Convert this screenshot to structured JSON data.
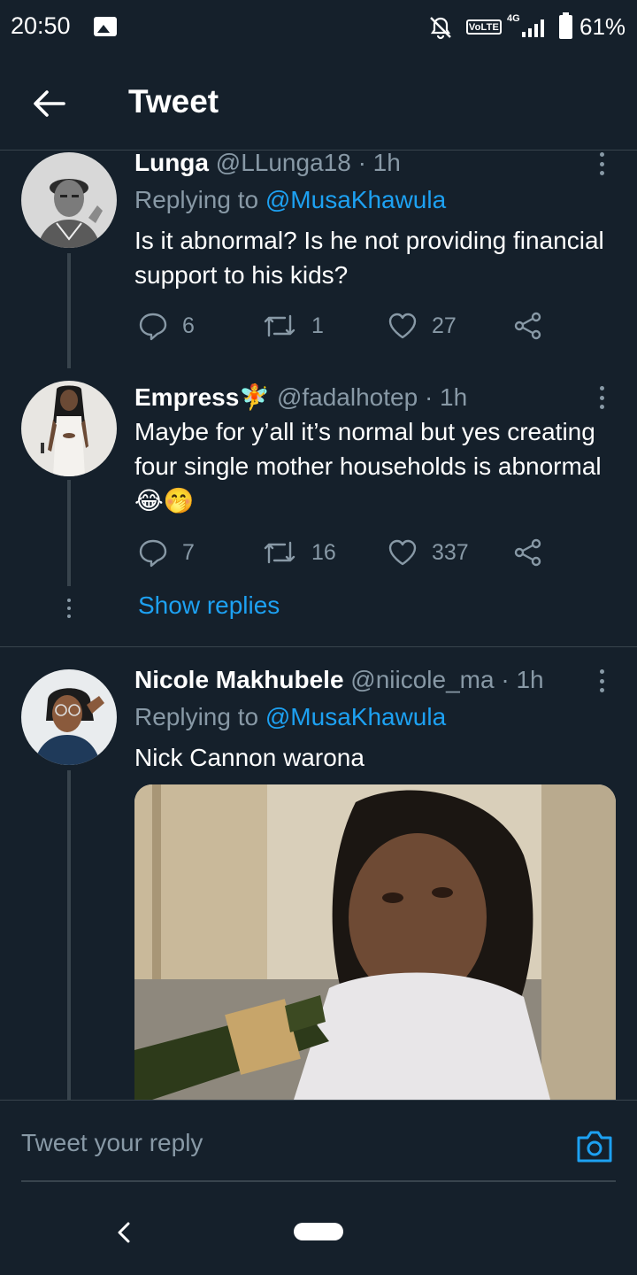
{
  "status_bar": {
    "time": "20:50",
    "volte": "VoLTE",
    "network": "4G",
    "battery_percent": "61%",
    "icons": [
      "gallery-icon",
      "mute-icon",
      "signal-icon",
      "battery-icon"
    ]
  },
  "header": {
    "title": "Tweet",
    "back_icon": "arrow-left-icon"
  },
  "tweets": [
    {
      "name": "Lunga",
      "handle": "@LLunga18 · 1h",
      "replying_prefix": "Replying to ",
      "replying_handle": "@MusaKhawula",
      "text": "Is it abnormal? Is he not providing financial support to his kids?",
      "replies": "6",
      "retweets": "1",
      "likes": "27"
    },
    {
      "name": "Empress",
      "name_emoji": "🧚",
      "handle": "@fadalhotep · 1h",
      "text": "Maybe for y’all it’s normal but yes creating four single mother households is abnormal 😂🤭",
      "replies": "7",
      "retweets": "16",
      "likes": "337",
      "show_replies": "Show replies"
    },
    {
      "name": "Nicole Makhubele",
      "handle": "@niicole_ma · 1h",
      "replying_prefix": "Replying to ",
      "replying_handle": "@MusaKhawula",
      "text": "Nick Cannon warona",
      "media": "photo of a woman with braided hair drinking from a wine bottle"
    }
  ],
  "reply_bar": {
    "placeholder": "Tweet your reply",
    "camera_icon": "camera-icon"
  },
  "colors": {
    "background": "#15202b",
    "accent": "#1da1f2",
    "secondary_text": "#8899a6",
    "divider": "#38444d"
  }
}
